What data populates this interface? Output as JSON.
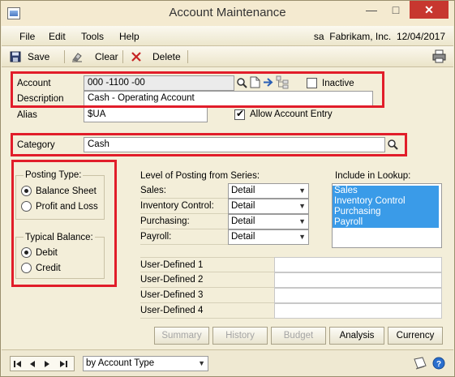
{
  "window": {
    "title": "Account Maintenance",
    "minimize_glyph": "—",
    "maximize_glyph": "□",
    "close_glyph": "✕"
  },
  "menu": {
    "items": [
      "File",
      "Edit",
      "Tools",
      "Help"
    ],
    "user": "sa",
    "company": "Fabrikam, Inc.",
    "date": "12/04/2017"
  },
  "toolbar": {
    "save_label": "Save",
    "clear_label": "Clear",
    "delete_label": "Delete"
  },
  "form": {
    "account_label": "Account",
    "account_value": "000 -1100 -00",
    "inactive_label": "Inactive",
    "inactive_checked": false,
    "description_label": "Description",
    "description_value": "Cash - Operating Account",
    "alias_label": "Alias",
    "alias_value": "$UA",
    "allow_entry_label": "Allow Account Entry",
    "allow_entry_checked": true,
    "category_label": "Category",
    "category_value": "Cash"
  },
  "posting_type": {
    "title": "Posting Type:",
    "options": [
      "Balance Sheet",
      "Profit and Loss"
    ],
    "selected": "Balance Sheet"
  },
  "typical_balance": {
    "title": "Typical Balance:",
    "options": [
      "Debit",
      "Credit"
    ],
    "selected": "Debit"
  },
  "level_of_posting": {
    "title": "Level of Posting from Series:",
    "rows": [
      {
        "label": "Sales:",
        "value": "Detail"
      },
      {
        "label": "Inventory Control:",
        "value": "Detail"
      },
      {
        "label": "Purchasing:",
        "value": "Detail"
      },
      {
        "label": "Payroll:",
        "value": "Detail"
      }
    ]
  },
  "lookup": {
    "title": "Include in Lookup:",
    "items": [
      "Sales",
      "Inventory Control",
      "Purchasing",
      "Payroll"
    ]
  },
  "user_defined": {
    "labels": [
      "User-Defined 1",
      "User-Defined 2",
      "User-Defined 3",
      "User-Defined 4"
    ]
  },
  "buttons": {
    "summary": "Summary",
    "history": "History",
    "budget": "Budget",
    "analysis": "Analysis",
    "currency": "Currency"
  },
  "statusbar": {
    "sort_value": "by Account Type"
  },
  "colors": {
    "highlight_red": "#e11d2a",
    "selection_blue": "#3a9be8"
  }
}
